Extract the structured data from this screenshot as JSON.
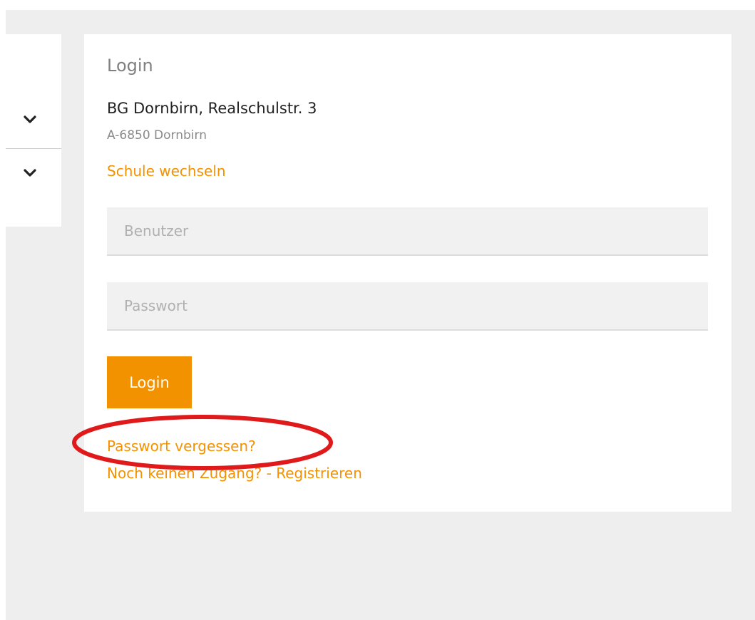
{
  "menu": {
    "items": [
      {
        "icon": "chevron-down-icon"
      },
      {
        "icon": "chevron-down-icon"
      }
    ]
  },
  "login": {
    "title": "Login",
    "school_name": "BG Dornbirn, Realschulstr. 3",
    "school_city": "A-6850 Dornbirn",
    "change_school": "Schule wechseln",
    "user_placeholder": "Benutzer",
    "user_value": "",
    "password_placeholder": "Passwort",
    "password_value": "",
    "login_button": "Login",
    "forgot_password": "Passwort vergessen?",
    "register": "Noch keinen Zugang? - Registrieren"
  },
  "colors": {
    "accent": "#f39200",
    "highlight": "#e0191b",
    "background": "#eeeeee"
  }
}
